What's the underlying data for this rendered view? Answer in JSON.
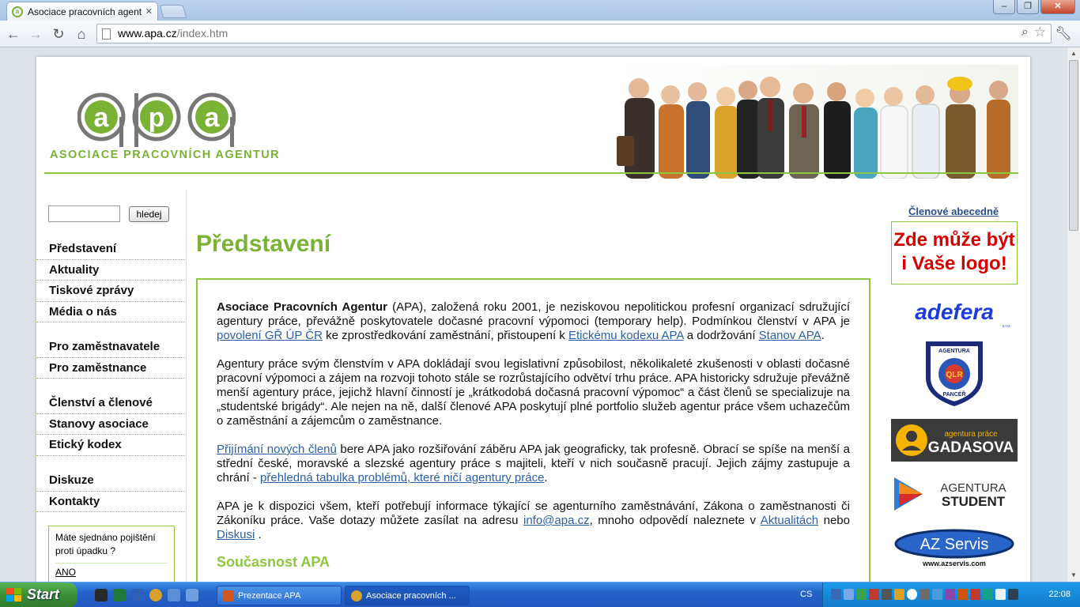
{
  "browser": {
    "tab_title": "Asociace pracovních agentur",
    "address_host": "www.apa.cz",
    "address_path": "/index.htm",
    "window_buttons": [
      "–",
      "❐",
      "✕"
    ]
  },
  "site": {
    "logo_letters": "apa",
    "logo_text": "ASOCIACE PRACOVNÍCH AGENTUR",
    "accent_color": "#8dc63f"
  },
  "search": {
    "button_label": "hledej",
    "value": ""
  },
  "menu": {
    "group1": [
      "Představení",
      "Aktuality",
      "Tiskové zprávy",
      "Média o nás"
    ],
    "group2": [
      "Pro zaměstnavatele",
      "Pro zaměstnance"
    ],
    "group3": [
      "Členství a členové",
      "Stanovy asociace",
      "Etický kodex"
    ],
    "group4": [
      "Diskuze",
      "Kontakty"
    ]
  },
  "poll": {
    "question": "Máte sjednáno pojištění proti úpadku ?",
    "answer": "ANO"
  },
  "main": {
    "title": "Představení",
    "p1": {
      "strong": "Asociace Pracovních Agentur",
      "t1": " (APA), založená roku 2001, je neziskovou nepolitickou profesní organizací sdružující agentury práce, převážně poskytovatele dočasné pracovní výpomoci (temporary help). Podmínkou členství v APA je ",
      "link1": "povolení GŘ ÚP ČR",
      "t2": " ke zprostředkování zaměstnání, přistoupení k ",
      "link2": "Etickému kodexu APA",
      "t3": " a dodržování ",
      "link3": "Stanov APA",
      "t4": "."
    },
    "p2": "Agentury práce svým členstvím v APA dokládají svou legislativní způsobilost, několikaleté zkušenosti v oblasti dočasné pracovní výpomoci a zájem na rozvoji tohoto stále se rozrůstajícího odvětví trhu práce. APA historicky sdružuje převážně menší agentury práce, jejichž hlavní činností je „krátkodobá dočasná pracovní výpomoc“ a část členů se specializuje na „studentské brigády“. Ale nejen na ně, další členové APA poskytují plné portfolio služeb agentur práce všem uchazečům o zaměstnání a zájemcům o zaměstnance.",
    "p3": {
      "link1": "Přijímání nových členů",
      "t1": " bere APA jako rozšiřování záběru APA jak geograficky, tak profesně. Obrací se spíše na menší a střední české, moravské a slezské agentury práce s majiteli, kteří v nich současně pracují. Jejich zájmy zastupuje a chrání - ",
      "link2": "přehledná tabulka problémů, které ničí agentury práce",
      "t2": "."
    },
    "p4": {
      "t1": "APA je k dispozici všem, kteří potřebují informace týkající se agenturního zaměstnávání, Zákona o zaměstnanosti či Zákoníku práce. Vaše dotazy můžete zasílat na adresu ",
      "link1": "info@apa.cz",
      "t2": ", mnoho odpovědí naleznete v ",
      "link2": "Aktualitách",
      "t3": " nebo ",
      "link3": "Diskusi",
      "t4": " ."
    },
    "subheading": "Současnost APA"
  },
  "right": {
    "members_link": "Členové abecedně",
    "ad_line1": "Zde může být",
    "ad_line2": "i Vaše logo!",
    "logos": {
      "adefera": "adefera",
      "adefera_sub": "s.r.o.",
      "pancer_top": "AGENTURA",
      "pancer_mid": "QLR",
      "pancer_bottom": "PANCÉŘ",
      "pancer_sub": "s.r.o.",
      "gadasova_top": "agentura práce",
      "gadasova": "GADASOVA",
      "student_line1": "AGENTURA",
      "student_line2": "STUDENT",
      "azservis": "AZ Servis",
      "azservis_url": "www.azservis.com"
    }
  },
  "taskbar": {
    "start": "Start",
    "task1": "Prezentace APA",
    "task2": "Asociace pracovních ...",
    "lang": "CS",
    "clock": "22:08"
  }
}
